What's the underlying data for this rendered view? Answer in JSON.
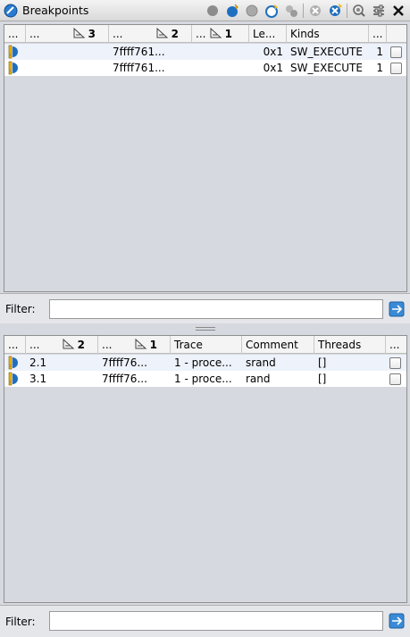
{
  "window": {
    "title": "Breakpoints"
  },
  "toolbar": {
    "icons": [
      "disable-all-icon",
      "enable-breakpoint-icon",
      "disable-breakpoint-icon",
      "new-breakpoint-icon",
      "toggle-group-icon",
      "clear-icon",
      "remove-all-icon",
      "zoom-icon",
      "filter-settings-icon",
      "close-icon"
    ]
  },
  "top_table": {
    "headers": [
      {
        "label": "...",
        "sort": ""
      },
      {
        "label": "...",
        "sort": "3"
      },
      {
        "label": "...",
        "sort": "2"
      },
      {
        "label": "...",
        "sort": "1"
      },
      {
        "label": "Le...",
        "sort": ""
      },
      {
        "label": "Kinds",
        "sort": ""
      },
      {
        "label": "...",
        "sort": ""
      },
      {
        "label": "",
        "sort": ""
      }
    ],
    "rows": [
      {
        "name": "",
        "address": "7ffff761...",
        "length": "0x1",
        "kinds": "SW_EXECUTE",
        "count": "1",
        "enabled": false
      },
      {
        "name": "",
        "address": "7ffff761...",
        "length": "0x1",
        "kinds": "SW_EXECUTE",
        "count": "1",
        "enabled": false
      }
    ],
    "filter": {
      "label": "Filter:",
      "value": ""
    }
  },
  "bottom_table": {
    "headers": [
      {
        "label": "...",
        "sort": ""
      },
      {
        "label": "...",
        "sort": "2"
      },
      {
        "label": "...",
        "sort": "1"
      },
      {
        "label": "Trace",
        "sort": ""
      },
      {
        "label": "Comment",
        "sort": ""
      },
      {
        "label": "Threads",
        "sort": ""
      },
      {
        "label": "...",
        "sort": ""
      }
    ],
    "rows": [
      {
        "id": "2.1",
        "address": "7ffff76...",
        "trace": "1 - proce...",
        "comment": "srand",
        "threads": "[]",
        "enabled": false
      },
      {
        "id": "3.1",
        "address": "7ffff76...",
        "trace": "1 - proce...",
        "comment": "rand",
        "threads": "[]",
        "enabled": false
      }
    ],
    "filter": {
      "label": "Filter:",
      "value": ""
    }
  },
  "colors": {
    "accent": "#1f6fc0",
    "warning": "#f2b600",
    "row_alt": "#eef2fa"
  }
}
